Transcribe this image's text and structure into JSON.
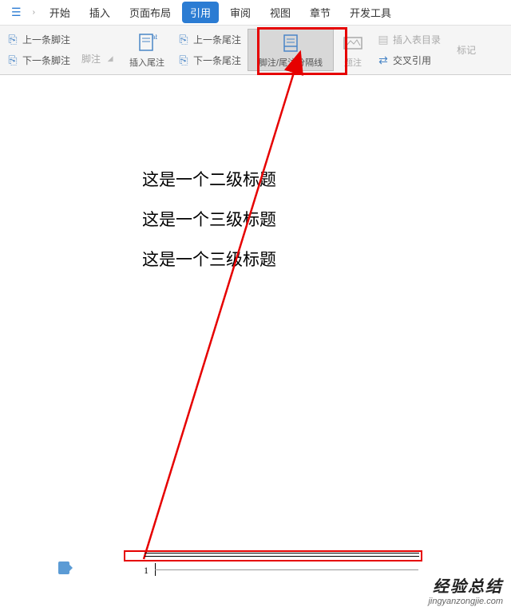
{
  "menubar": {
    "items": [
      "开始",
      "插入",
      "页面布局",
      "引用",
      "审阅",
      "视图",
      "章节",
      "开发工具"
    ]
  },
  "toolbar": {
    "prev_footnote": "上一条脚注",
    "next_footnote": "下一条脚注",
    "footnote_label": "脚注",
    "insert_endnote": "插入尾注",
    "prev_endnote": "上一条尾注",
    "next_endnote": "下一条尾注",
    "separator": "脚注/尾注分隔线",
    "caption": "题注",
    "insert_toc": "插入表目录",
    "cross_ref": "交叉引用",
    "mark": "标记"
  },
  "document": {
    "heading1": "这是一个二级标题",
    "heading2": "这是一个三级标题",
    "heading3": "这是一个三级标题",
    "page_num": "1"
  },
  "watermark": {
    "cn": "经验总结",
    "en": "jingyanzongjie.com"
  }
}
